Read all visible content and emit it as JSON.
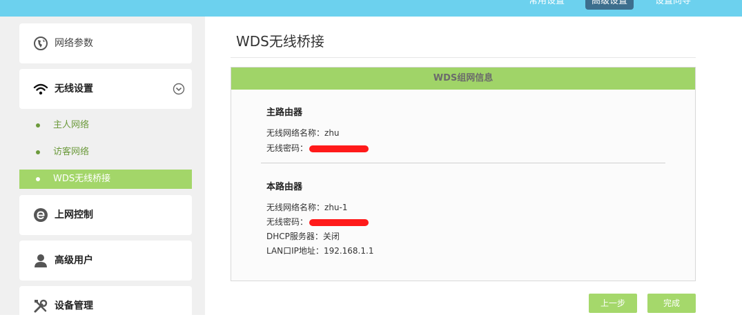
{
  "topnav": {
    "items": [
      {
        "label": "常用设置",
        "active": false
      },
      {
        "label": "高级设置",
        "active": true
      },
      {
        "label": "设置向导",
        "active": false
      }
    ]
  },
  "sidebar": {
    "items": [
      {
        "label": "网络参数",
        "icon": "globe-icon"
      },
      {
        "label": "无线设置",
        "icon": "wifi-icon",
        "expanded": true
      },
      {
        "label": "上网控制",
        "icon": "internet-e-icon"
      },
      {
        "label": "高级用户",
        "icon": "user-icon"
      },
      {
        "label": "设备管理",
        "icon": "tools-icon"
      }
    ],
    "sub_items": [
      {
        "label": "主人网络",
        "active": false
      },
      {
        "label": "访客网络",
        "active": false
      },
      {
        "label": "WDS无线桥接",
        "active": true
      }
    ]
  },
  "main": {
    "title": "WDS无线桥接",
    "panel": {
      "header": "WDS组网信息",
      "main_router": {
        "title": "主路由器",
        "ssid_label": "无线网络名称：",
        "ssid_value": "zhu",
        "password_label": "无线密码："
      },
      "this_router": {
        "title": "本路由器",
        "ssid_label": "无线网络名称：",
        "ssid_value": "zhu-1",
        "password_label": "无线密码：",
        "dhcp_label": "DHCP服务器：",
        "dhcp_value": "关闭",
        "lan_ip_label": "LAN口IP地址：",
        "lan_ip_value": "192.168.1.1"
      }
    },
    "buttons": {
      "prev": "上一步",
      "finish": "完成"
    }
  },
  "colors": {
    "topbar": "#6cd1ee",
    "accent_green": "#a0d468",
    "sub_text_green": "#6c9a3c",
    "redaction": "#ff1a1a"
  }
}
